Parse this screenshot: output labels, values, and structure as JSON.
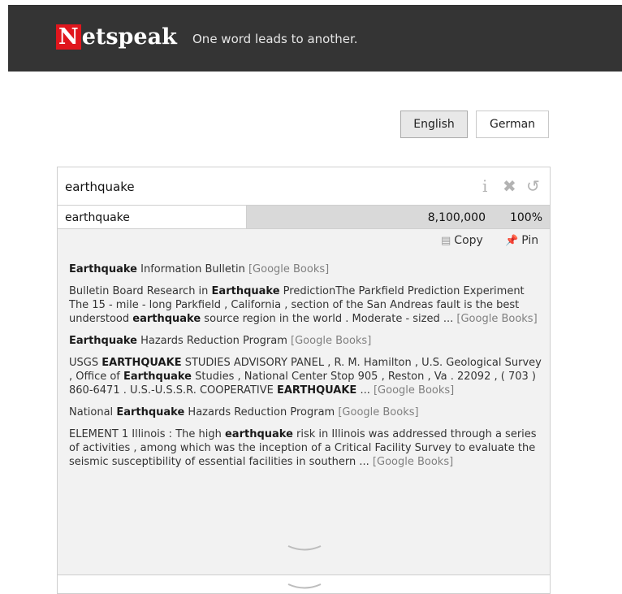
{
  "header": {
    "logo_first": "N",
    "logo_rest": "etspeak",
    "tagline": "One word leads to another."
  },
  "languages": [
    {
      "label": "English",
      "selected": true
    },
    {
      "label": "German",
      "selected": false
    }
  ],
  "search": {
    "query": "earthquake"
  },
  "toolbar_icons": [
    "info-icon",
    "clear-icon",
    "history-icon"
  ],
  "result": {
    "phrase": "earthquake",
    "frequency": "8,100,000",
    "percent": "100%",
    "percent_value": 1.0
  },
  "actions": {
    "copy": "Copy",
    "pin": "Pin"
  },
  "snippets": [
    {
      "parts": [
        {
          "t": "Earthquake",
          "b": true
        },
        {
          "t": " Information Bulletin ",
          "b": false
        }
      ],
      "source": "[Google Books]"
    },
    {
      "parts": [
        {
          "t": "Bulletin Board Research in ",
          "b": false
        },
        {
          "t": "Earthquake",
          "b": true
        },
        {
          "t": " PredictionThe Parkfield Prediction Experiment The 15 - mile - long Parkfield , California , section of the San Andreas fault is the best understood ",
          "b": false
        },
        {
          "t": "earthquake",
          "b": true
        },
        {
          "t": " source region in the world . Moderate - sized ... ",
          "b": false
        }
      ],
      "source": "[Google Books]"
    },
    {
      "parts": [
        {
          "t": "Earthquake",
          "b": true
        },
        {
          "t": " Hazards Reduction Program ",
          "b": false
        }
      ],
      "source": "[Google Books]"
    },
    {
      "parts": [
        {
          "t": "USGS ",
          "b": false
        },
        {
          "t": "EARTHQUAKE",
          "b": true
        },
        {
          "t": " STUDIES ADVISORY PANEL , R. M. Hamilton , U.S. Geological Survey , Office of ",
          "b": false
        },
        {
          "t": "Earthquake",
          "b": true
        },
        {
          "t": " Studies , National Center Stop 905 , Reston , Va . 22092 , ( 703 ) 860-6471 . U.S.-U.S.S.R. COOPERATIVE ",
          "b": false
        },
        {
          "t": "EARTHQUAKE",
          "b": true
        },
        {
          "t": " ... ",
          "b": false
        }
      ],
      "source": "[Google Books]"
    },
    {
      "parts": [
        {
          "t": "National ",
          "b": false
        },
        {
          "t": "Earthquake",
          "b": true
        },
        {
          "t": " Hazards Reduction Program ",
          "b": false
        }
      ],
      "source": "[Google Books]"
    },
    {
      "parts": [
        {
          "t": "ELEMENT 1 Illinois : The high ",
          "b": false
        },
        {
          "t": "earthquake",
          "b": true
        },
        {
          "t": " risk in Illinois was addressed through a series of activities , among which was the inception of a Critical Facility Survey to evaluate the seismic susceptibility of essential facilities in southern ... ",
          "b": false
        }
      ],
      "source": "[Google Books]"
    }
  ],
  "icons": {
    "more": "chevron-down-icon",
    "next": "chevron-down-icon"
  }
}
